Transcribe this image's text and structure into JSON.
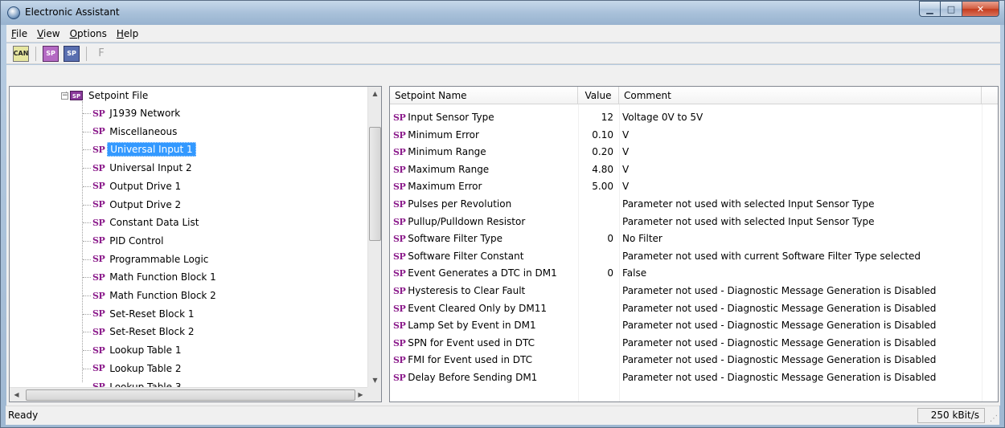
{
  "window": {
    "title": "Electronic Assistant"
  },
  "menu": [
    {
      "label": "File",
      "key": "F",
      "rest": "ile"
    },
    {
      "label": "View",
      "key": "V",
      "rest": "iew"
    },
    {
      "label": "Options",
      "key": "O",
      "rest": "ptions"
    },
    {
      "label": "Help",
      "key": "H",
      "rest": "elp"
    }
  ],
  "toolbar": {
    "can_icon": "CAN",
    "open_icon": "SP",
    "save_icon": "SP",
    "flash_label": "F"
  },
  "tree": {
    "root_label": "Setpoint File",
    "icon_text": "SP",
    "items": [
      "J1939 Network",
      "Miscellaneous",
      "Universal Input 1",
      "Universal Input 2",
      "Output Drive 1",
      "Output Drive 2",
      "Constant Data List",
      "PID Control",
      "Programmable Logic",
      "Math Function Block 1",
      "Math Function Block 2",
      "Set-Reset Block 1",
      "Set-Reset Block 2",
      "Lookup Table 1",
      "Lookup Table 2",
      "Lookup Table 3"
    ],
    "selected_index": 2
  },
  "table": {
    "headers": {
      "name": "Setpoint Name",
      "value": "Value",
      "comment": "Comment"
    },
    "row_icon": "SP",
    "rows": [
      {
        "name": "Input Sensor Type",
        "value": "12",
        "comment": "Voltage 0V to 5V"
      },
      {
        "name": "Minimum Error",
        "value": "0.10",
        "comment": "V"
      },
      {
        "name": "Minimum Range",
        "value": "0.20",
        "comment": "V"
      },
      {
        "name": "Maximum Range",
        "value": "4.80",
        "comment": "V"
      },
      {
        "name": "Maximum Error",
        "value": "5.00",
        "comment": "V"
      },
      {
        "name": "Pulses per Revolution",
        "value": "",
        "comment": "Parameter not used with selected Input Sensor Type"
      },
      {
        "name": "Pullup/Pulldown Resistor",
        "value": "",
        "comment": "Parameter not used with selected Input Sensor Type"
      },
      {
        "name": "Software Filter Type",
        "value": "0",
        "comment": "No Filter"
      },
      {
        "name": "Software Filter Constant",
        "value": "",
        "comment": "Parameter not used with current Software Filter Type selected"
      },
      {
        "name": "Event Generates a DTC in DM1",
        "value": "0",
        "comment": "False"
      },
      {
        "name": "Hysteresis to Clear Fault",
        "value": "",
        "comment": "Parameter not used - Diagnostic Message Generation is Disabled"
      },
      {
        "name": "Event Cleared Only by DM11",
        "value": "",
        "comment": "Parameter not used - Diagnostic Message Generation is Disabled"
      },
      {
        "name": "Lamp Set by Event in DM1",
        "value": "",
        "comment": "Parameter not used - Diagnostic Message Generation is Disabled"
      },
      {
        "name": "SPN for Event used in DTC",
        "value": "",
        "comment": "Parameter not used - Diagnostic Message Generation is Disabled"
      },
      {
        "name": "FMI for Event used in DTC",
        "value": "",
        "comment": "Parameter not used - Diagnostic Message Generation is Disabled"
      },
      {
        "name": "Delay Before Sending DM1",
        "value": "",
        "comment": "Parameter not used - Diagnostic Message Generation is Disabled"
      }
    ]
  },
  "status": {
    "text": "Ready",
    "baud": "250 kBit/s"
  },
  "colors": {
    "selection": "#3399ff",
    "sp_icon": "#8b1b8b"
  }
}
